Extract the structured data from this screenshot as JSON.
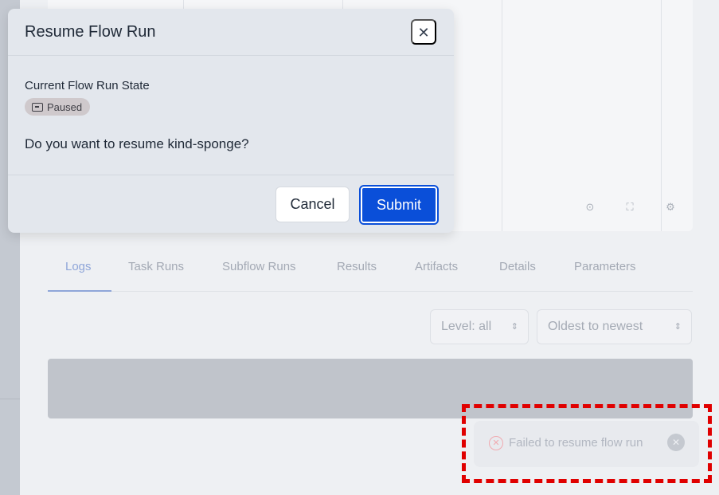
{
  "modal": {
    "title": "Resume Flow Run",
    "close_icon": "close-icon",
    "state_label": "Current Flow Run State",
    "state_badge": {
      "icon": "pause-square-icon",
      "label": "Paused"
    },
    "question": "Do you want to resume kind-sponge?",
    "cancel_label": "Cancel",
    "submit_label": "Submit"
  },
  "graph_toolbar": {
    "icons": [
      "crosshair-icon",
      "expand-icon",
      "settings-icon"
    ]
  },
  "tabs": [
    {
      "label": "Logs",
      "active": true
    },
    {
      "label": "Task Runs",
      "active": false
    },
    {
      "label": "Subflow Runs",
      "active": false
    },
    {
      "label": "Results",
      "active": false
    },
    {
      "label": "Artifacts",
      "active": false
    },
    {
      "label": "Details",
      "active": false
    },
    {
      "label": "Parameters",
      "active": false
    }
  ],
  "log_filters": {
    "level": "Level: all",
    "order": "Oldest to newest"
  },
  "toast": {
    "icon": "error-circle-icon",
    "message": "Failed to resume flow run",
    "close_icon": "close-circle-icon"
  },
  "colors": {
    "primary": "#0a4fd9",
    "modal_bg": "#e3e7ed",
    "highlight": "#e00000",
    "error": "#f0aab0"
  }
}
